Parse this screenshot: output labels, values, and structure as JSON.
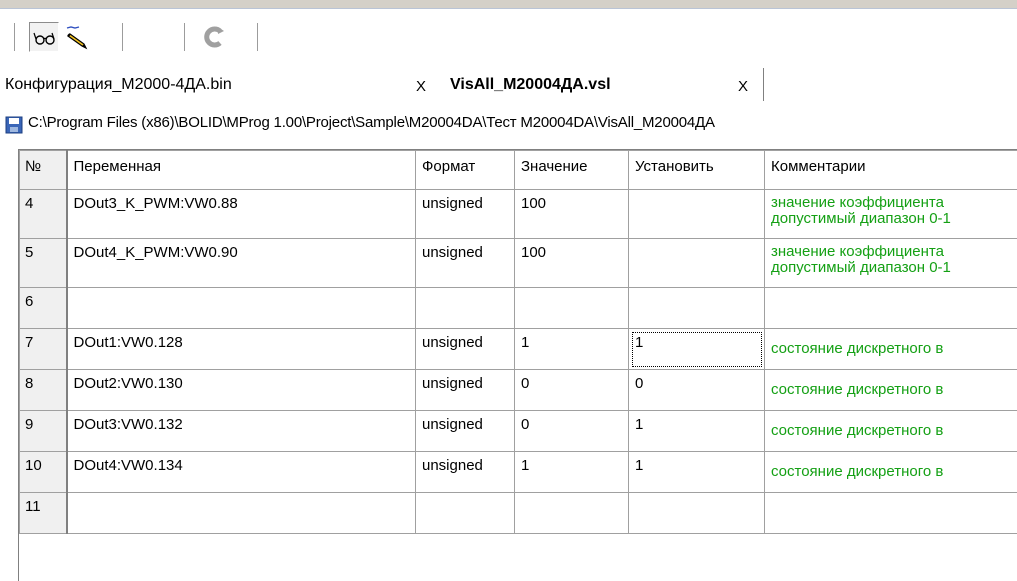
{
  "toolbar": {
    "icons": [
      "glasses-icon",
      "pencil-icon",
      "refresh-icon"
    ]
  },
  "tabs": [
    {
      "label": "Конфигурация_М2000-4ДА.bin",
      "close": "X",
      "active": false
    },
    {
      "label": "VisAll_М20004ДА.vsl",
      "close": "X",
      "active": true
    }
  ],
  "path": {
    "icon": "save-icon",
    "text": "C:\\Program Files (x86)\\BOLID\\MProg 1.00\\Project\\Sample\\M20004DA\\Тест М20004DA\\VisAll_M20004ДА"
  },
  "table": {
    "headers": {
      "num": "№",
      "variable": "Переменная",
      "format": "Формат",
      "value": "Значение",
      "set": "Установить",
      "comment": "Комментарии"
    },
    "rows": [
      {
        "num": "4",
        "variable": "DOut3_K_PWM:VW0.88",
        "format": "unsigned",
        "value": "100",
        "set": "",
        "comment1": "значение коэффициента",
        "comment2": "допустимый диапазон 0-1"
      },
      {
        "num": "5",
        "variable": "DOut4_K_PWM:VW0.90",
        "format": "unsigned",
        "value": "100",
        "set": "",
        "comment1": "значение коэффициента",
        "comment2": "допустимый диапазон 0-1"
      },
      {
        "num": "6",
        "variable": "",
        "format": "",
        "value": "",
        "set": "",
        "comment1": "",
        "comment2": ""
      },
      {
        "num": "7",
        "variable": "DOut1:VW0.128",
        "format": "unsigned",
        "value": "1",
        "set": "1",
        "comment1": "состояние дискретного в",
        "comment2": ""
      },
      {
        "num": "8",
        "variable": "DOut2:VW0.130",
        "format": "unsigned",
        "value": "0",
        "set": "0",
        "comment1": "состояние дискретного в",
        "comment2": ""
      },
      {
        "num": "9",
        "variable": "DOut3:VW0.132",
        "format": "unsigned",
        "value": "0",
        "set": "1",
        "comment1": "состояние дискретного в",
        "comment2": ""
      },
      {
        "num": "10",
        "variable": "DOut4:VW0.134",
        "format": "unsigned",
        "value": "1",
        "set": "1",
        "comment1": "состояние дискретного в",
        "comment2": ""
      },
      {
        "num": "11",
        "variable": "",
        "format": "",
        "value": "",
        "set": "",
        "comment1": "",
        "comment2": ""
      }
    ]
  },
  "colors": {
    "comment_text": "#14a014",
    "toolbar_bg": "#d4d0c8",
    "rownum_bg": "#f0f0f0"
  }
}
